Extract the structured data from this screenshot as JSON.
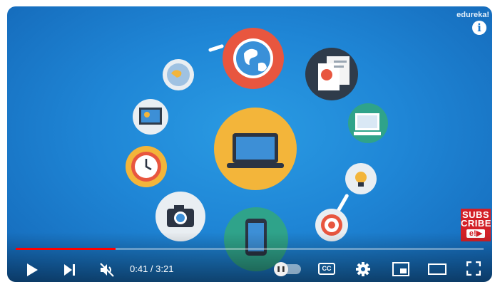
{
  "video": {
    "channel_watermark": "edureka!",
    "info_icon": "info-icon",
    "subscribe_badge": {
      "line1": "SUBS",
      "line2": "CRIBE",
      "logo": "e!▶"
    }
  },
  "player": {
    "progress_fraction": 0.213,
    "current_time": "0:41",
    "separator": " / ",
    "duration": "3:21",
    "cc_label": "CC",
    "icons": [
      "play-icon",
      "next-icon",
      "mute-icon",
      "autoplay-icon",
      "cc-icon",
      "settings-icon",
      "miniplayer-icon",
      "theater-icon",
      "fullscreen-icon"
    ],
    "accent_color": "#ff0000"
  }
}
